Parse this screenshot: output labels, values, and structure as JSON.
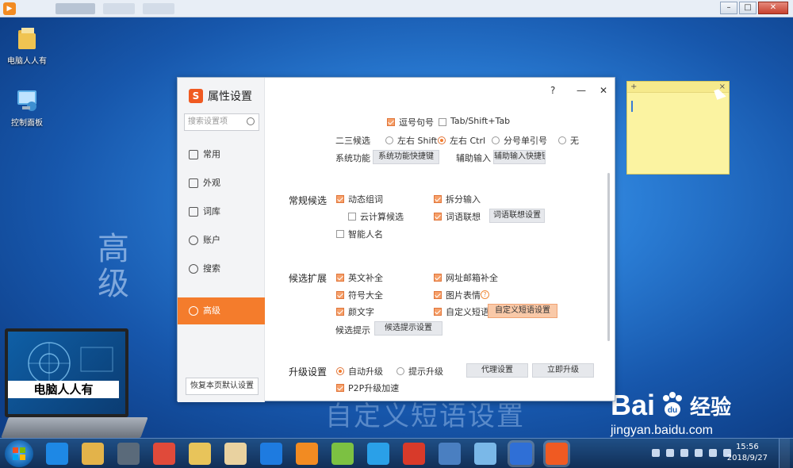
{
  "player": {
    "tabs": [
      "",
      "",
      ""
    ],
    "window_buttons": {
      "minimize": "–",
      "restore": "□",
      "close": "✕"
    }
  },
  "desktop": {
    "icons": [
      {
        "label": "电脑人人有",
        "icon": "folder-icon"
      },
      {
        "label": "控制面板",
        "icon": "control-panel-icon"
      }
    ],
    "side_caption": "高级",
    "laptop_banner": "电脑人人有",
    "watermark": "自定义短语设置",
    "baidu_logo": "Bai",
    "baidu_logo_cn": "经验",
    "baidu_url": "jingyan.baidu.com"
  },
  "sticky_note": {
    "add": "+",
    "close": "×"
  },
  "dialog": {
    "title": "属性设置",
    "search_placeholder": "搜索设置项",
    "controls": {
      "help": "?",
      "minimize": "—",
      "close": "✕"
    },
    "nav": [
      {
        "label": "常用",
        "icon": "monitor-icon"
      },
      {
        "label": "外观",
        "icon": "shirt-icon"
      },
      {
        "label": "词库",
        "icon": "book-icon"
      },
      {
        "label": "账户",
        "icon": "user-icon"
      },
      {
        "label": "搜索",
        "icon": "search-icon"
      },
      {
        "label": "高级",
        "icon": "gear-icon",
        "active": true
      }
    ],
    "restore_defaults": "恢复本页默认设置",
    "top": {
      "comma_period": "逗号句号",
      "tab_shift": "Tab/Shift+Tab",
      "second_third_label": "二三候选",
      "options": [
        "左右 Shift",
        "左右 Ctrl",
        "分号单引号",
        "无"
      ],
      "selected_option": "左右 Ctrl",
      "system_function_label": "系统功能",
      "system_function_button": "系统功能快捷键",
      "assist_input_label": "辅助输入",
      "assist_input_button": "辅助输入快捷键"
    },
    "common_candidates": {
      "section": "常规候选",
      "dynamic_phrase": "动态组词",
      "split_input": "拆分输入",
      "cloud_candidate": "云计算候选",
      "word_association": "词语联想",
      "word_association_button": "词语联想设置",
      "smart_name": "智能人名"
    },
    "extended_candidates": {
      "section": "候选扩展",
      "english_completion": "英文补全",
      "url_email_completion": "网址邮箱补全",
      "symbol_collection": "符号大全",
      "image_emoji": "图片表情",
      "kaomoji": "颜文字",
      "custom_phrase": "自定义短语",
      "custom_phrase_button": "自定义短语设置",
      "candidate_tip_label": "候选提示",
      "candidate_tip_button": "候选提示设置"
    },
    "upgrade": {
      "section": "升级设置",
      "auto_upgrade": "自动升级",
      "prompt_upgrade": "提示升级",
      "proxy_button": "代理设置",
      "upgrade_now_button": "立即升级",
      "p2p": "P2P升级加速"
    }
  },
  "taskbar": {
    "time": "15:56",
    "date": "2018/9/27",
    "apps": [
      {
        "name": "ie-icon",
        "color": "#1e88e5"
      },
      {
        "name": "explorer-icon",
        "color": "#e3b34a"
      },
      {
        "name": "media-icon",
        "color": "#5a6a7a"
      },
      {
        "name": "chrome-icon",
        "color": "#e04a3a"
      },
      {
        "name": "folder-icon",
        "color": "#e8c45a"
      },
      {
        "name": "paint-icon",
        "color": "#e9d2a0"
      },
      {
        "name": "sogou-browser-icon",
        "color": "#1e7be0"
      },
      {
        "name": "player-icon",
        "color": "#f28b22"
      },
      {
        "name": "pinwheel-icon",
        "color": "#7cc142"
      },
      {
        "name": "bird-icon",
        "color": "#2aa0e8"
      },
      {
        "name": "chess-icon",
        "color": "#d83a2a"
      },
      {
        "name": "circle-app-icon",
        "color": "#4a7fc1"
      },
      {
        "name": "fan-icon",
        "color": "#7ab8e8"
      },
      {
        "name": "shield-icon",
        "color": "#2f6fd6"
      },
      {
        "name": "sogou-input-icon",
        "color": "#f05a22"
      }
    ]
  }
}
